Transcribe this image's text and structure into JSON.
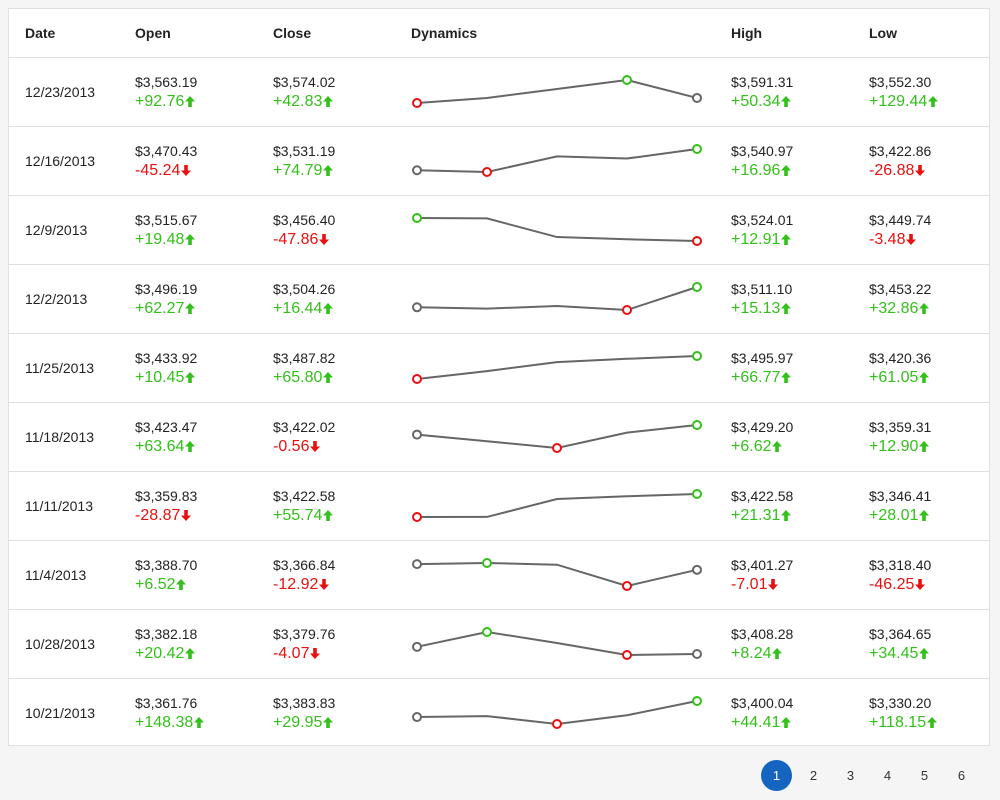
{
  "columns": {
    "date": "Date",
    "open": "Open",
    "close": "Close",
    "dynamics": "Dynamics",
    "high": "High",
    "low": "Low"
  },
  "colors": {
    "up": "#33c01a",
    "down": "#e81010",
    "neutral": "#666666",
    "active_page": "#1565c0"
  },
  "rows": [
    {
      "date": "12/23/2013",
      "open": {
        "value": "$3,563.19",
        "delta": "+92.76",
        "dir": "up"
      },
      "close": {
        "value": "$3,574.02",
        "delta": "+42.83",
        "dir": "up"
      },
      "high": {
        "value": "$3,591.31",
        "delta": "+50.34",
        "dir": "up"
      },
      "low": {
        "value": "$3,552.30",
        "delta": "+129.44",
        "dir": "up"
      },
      "dynamics": [
        3563.19,
        3566,
        3571,
        3576,
        3566
      ]
    },
    {
      "date": "12/16/2013",
      "open": {
        "value": "$3,470.43",
        "delta": "-45.24",
        "dir": "down"
      },
      "close": {
        "value": "$3,531.19",
        "delta": "+74.79",
        "dir": "up"
      },
      "high": {
        "value": "$3,540.97",
        "delta": "+16.96",
        "dir": "up"
      },
      "low": {
        "value": "$3,422.86",
        "delta": "-26.88",
        "dir": "down"
      },
      "dynamics": [
        3490,
        3486,
        3522,
        3517,
        3539
      ]
    },
    {
      "date": "12/9/2013",
      "open": {
        "value": "$3,515.67",
        "delta": "+19.48",
        "dir": "up"
      },
      "close": {
        "value": "$3,456.40",
        "delta": "-47.86",
        "dir": "down"
      },
      "high": {
        "value": "$3,524.01",
        "delta": "+12.91",
        "dir": "up"
      },
      "low": {
        "value": "$3,449.74",
        "delta": "-3.48",
        "dir": "down"
      },
      "dynamics": [
        3515.67,
        3515,
        3482,
        3478,
        3475
      ]
    },
    {
      "date": "12/2/2013",
      "open": {
        "value": "$3,496.19",
        "delta": "+62.27",
        "dir": "up"
      },
      "close": {
        "value": "$3,504.26",
        "delta": "+16.44",
        "dir": "up"
      },
      "high": {
        "value": "$3,511.10",
        "delta": "+15.13",
        "dir": "up"
      },
      "low": {
        "value": "$3,453.22",
        "delta": "+32.86",
        "dir": "up"
      },
      "dynamics": [
        3485,
        3484,
        3486,
        3483,
        3500
      ]
    },
    {
      "date": "11/25/2013",
      "open": {
        "value": "$3,433.92",
        "delta": "+10.45",
        "dir": "up"
      },
      "close": {
        "value": "$3,487.82",
        "delta": "+65.80",
        "dir": "up"
      },
      "high": {
        "value": "$3,495.97",
        "delta": "+66.77",
        "dir": "up"
      },
      "low": {
        "value": "$3,420.36",
        "delta": "+61.05",
        "dir": "up"
      },
      "dynamics": [
        3433.92,
        3448,
        3464,
        3470,
        3475
      ]
    },
    {
      "date": "11/18/2013",
      "open": {
        "value": "$3,423.47",
        "delta": "+63.64",
        "dir": "up"
      },
      "close": {
        "value": "$3,422.02",
        "delta": "-0.56",
        "dir": "down"
      },
      "high": {
        "value": "$3,429.20",
        "delta": "+6.62",
        "dir": "up"
      },
      "low": {
        "value": "$3,359.31",
        "delta": "+12.90",
        "dir": "up"
      },
      "dynamics": [
        3405,
        3398,
        3391,
        3407,
        3415
      ]
    },
    {
      "date": "11/11/2013",
      "open": {
        "value": "$3,359.83",
        "delta": "-28.87",
        "dir": "down"
      },
      "close": {
        "value": "$3,422.58",
        "delta": "+55.74",
        "dir": "up"
      },
      "high": {
        "value": "$3,422.58",
        "delta": "+21.31",
        "dir": "up"
      },
      "low": {
        "value": "$3,346.41",
        "delta": "+28.01",
        "dir": "up"
      },
      "dynamics": [
        3359.83,
        3360,
        3407,
        3414,
        3420
      ]
    },
    {
      "date": "11/4/2013",
      "open": {
        "value": "$3,388.70",
        "delta": "+6.52",
        "dir": "up"
      },
      "close": {
        "value": "$3,366.84",
        "delta": "-12.92",
        "dir": "down"
      },
      "high": {
        "value": "$3,401.27",
        "delta": "-7.01",
        "dir": "down"
      },
      "low": {
        "value": "$3,318.40",
        "delta": "-46.25",
        "dir": "down"
      },
      "dynamics": [
        3388.7,
        3390,
        3388,
        3363,
        3382
      ]
    },
    {
      "date": "10/28/2013",
      "open": {
        "value": "$3,382.18",
        "delta": "+20.42",
        "dir": "up"
      },
      "close": {
        "value": "$3,379.76",
        "delta": "-4.07",
        "dir": "down"
      },
      "high": {
        "value": "$3,408.28",
        "delta": "+8.24",
        "dir": "up"
      },
      "low": {
        "value": "$3,364.65",
        "delta": "+34.45",
        "dir": "up"
      },
      "dynamics": [
        3382.18,
        3397,
        3386,
        3374,
        3375
      ]
    },
    {
      "date": "10/21/2013",
      "open": {
        "value": "$3,361.76",
        "delta": "+148.38",
        "dir": "up"
      },
      "close": {
        "value": "$3,383.83",
        "delta": "+29.95",
        "dir": "up"
      },
      "high": {
        "value": "$3,400.04",
        "delta": "+44.41",
        "dir": "up"
      },
      "low": {
        "value": "$3,330.20",
        "delta": "+118.15",
        "dir": "up"
      },
      "dynamics": [
        3361.76,
        3363,
        3353,
        3364,
        3382
      ]
    }
  ],
  "pager": {
    "pages": [
      "1",
      "2",
      "3",
      "4",
      "5",
      "6"
    ],
    "active": "1"
  }
}
